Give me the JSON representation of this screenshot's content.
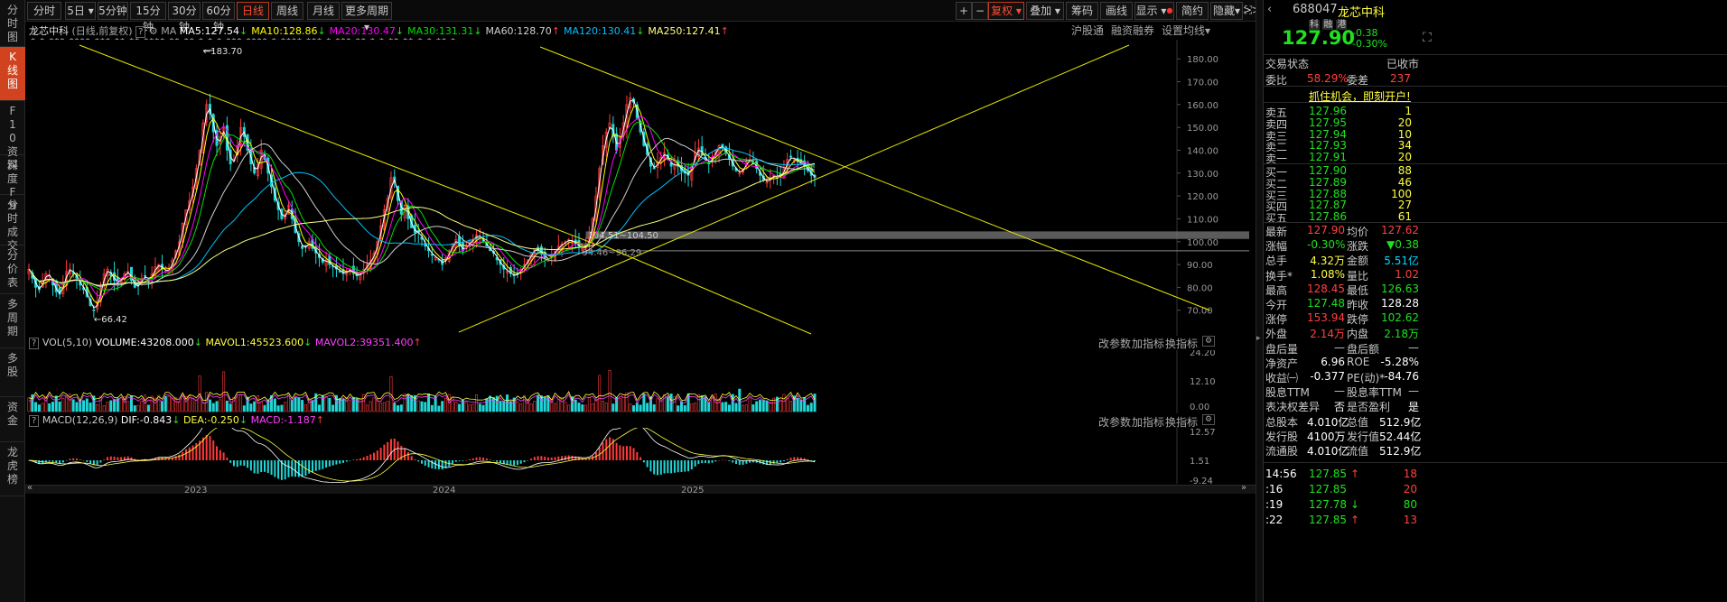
{
  "left_tabs": [
    "分时图",
    "K线图",
    "F10资料",
    "深度F9",
    "分时成交",
    "分价表",
    "多周期",
    "多股",
    "资金",
    "龙虎榜"
  ],
  "periods": [
    "分时",
    "5日",
    "5分钟",
    "15分钟",
    "30分钟",
    "60分钟",
    "日线",
    "周线",
    "月线",
    "更多周期"
  ],
  "toolbar": {
    "plus": "+",
    "minus": "−",
    "restore": "复权",
    "overlay": "叠加",
    "chips": "筹码",
    "draw": "画线",
    "display": "显示",
    "brief": "简约",
    "hide": "隐藏",
    "fwd": ">>",
    "expand": "⛶"
  },
  "chart": {
    "name": "龙芯中科",
    "mode": "(日线,前复权)",
    "ma_label": "MA",
    "ma": [
      {
        "name": "MA5",
        "value": "127.54",
        "color": "#ffffff",
        "arrow": "↓"
      },
      {
        "name": "MA10",
        "value": "128.86",
        "color": "#ffff00",
        "arrow": "↓"
      },
      {
        "name": "MA20",
        "value": "130.47",
        "color": "#ff00ff",
        "arrow": "↓"
      },
      {
        "name": "MA30",
        "value": "131.31",
        "color": "#00e000",
        "arrow": "↓"
      },
      {
        "name": "MA60",
        "value": "128.70",
        "color": "#d0d0d0",
        "arrow": "↑"
      },
      {
        "name": "MA120",
        "value": "130.41",
        "color": "#00c0ff",
        "arrow": "↓"
      },
      {
        "name": "MA250",
        "value": "127.41",
        "color": "#ffff80",
        "arrow": "↑"
      }
    ],
    "links": [
      "沪股通",
      "融资融券",
      "设置均线"
    ],
    "price_ticks": [
      "180.00",
      "170.00",
      "160.00",
      "150.00",
      "140.00",
      "130.00",
      "120.00",
      "110.00",
      "100.00",
      "90.00",
      "80.00",
      "70.00"
    ],
    "high_label": "183.70",
    "low_label": "66.42",
    "band_labels": [
      "104.51~104.50",
      "94.46~96.29"
    ],
    "x_labels": [
      "2023",
      "2024",
      "2025"
    ],
    "overlay_text": "*  *  *** **** ***  ** ** **** ** ** * *  * *** **** *  ****  *** * *** ** *  *  ** ** * *  ** *",
    "series": {
      "close": [
        88,
        84,
        80,
        79,
        83,
        86,
        85,
        81,
        78,
        77,
        82,
        87,
        88,
        86,
        84,
        81,
        79,
        76,
        72,
        70,
        74,
        80,
        86,
        88,
        85,
        83,
        82,
        84,
        86,
        87,
        83,
        80,
        81,
        84,
        85,
        83,
        86,
        89,
        90,
        88,
        87,
        88,
        92,
        96,
        100,
        108,
        114,
        118,
        124,
        132,
        140,
        152,
        160,
        156,
        148,
        142,
        146,
        150,
        140,
        134,
        136,
        142,
        150,
        146,
        140,
        134,
        130,
        134,
        140,
        136,
        130,
        124,
        118,
        114,
        110,
        112,
        116,
        110,
        104,
        100,
        97,
        98,
        100,
        97,
        95,
        93,
        91,
        92,
        90,
        89,
        88,
        87,
        86,
        87,
        88,
        86,
        85,
        86,
        88,
        90,
        92,
        95,
        100,
        107,
        114,
        119,
        128,
        126,
        118,
        112,
        116,
        110,
        106,
        104,
        104,
        101,
        98,
        96,
        94,
        93,
        92,
        90,
        93,
        96,
        99,
        101,
        98,
        96,
        98,
        100,
        101,
        103,
        102,
        100,
        98,
        96,
        95,
        92,
        90,
        88,
        87,
        86,
        85,
        86,
        88,
        90,
        92,
        95,
        97,
        96,
        95,
        93,
        92,
        94,
        96,
        98,
        99,
        100,
        101,
        100,
        99,
        98,
        97,
        98,
        102,
        110,
        120,
        132,
        142,
        148,
        152,
        146,
        140,
        146,
        152,
        160,
        163,
        161,
        154,
        148,
        142,
        138,
        133,
        132,
        135,
        137,
        139,
        136,
        133,
        134,
        133,
        131,
        130,
        129,
        134,
        139,
        141,
        138,
        136,
        134,
        137,
        140,
        142,
        141,
        139,
        136,
        133,
        131,
        130,
        132,
        135,
        136,
        134,
        132,
        129,
        127,
        126,
        128,
        129,
        128,
        129,
        132,
        136,
        137,
        136,
        135,
        134,
        133,
        131,
        129,
        128
      ],
      "minimum": 62,
      "maximum": 186
    },
    "vol": {
      "label": "VOL(5,10)",
      "volume": "VOLUME:43208.000",
      "volume_arrow": "↓",
      "mavol1": "MAVOL1:45523.600",
      "mavol1_arrow": "↓",
      "mavol2": "MAVOL2:39351.400",
      "mavol2_arrow": "↑",
      "ticks": [
        "24.20",
        "12.10",
        "0.00"
      ]
    },
    "macd": {
      "label": "MACD(12,26,9)",
      "dif": "DIF:-0.843",
      "dif_arrow": "↓",
      "dea": "DEA:-0.250",
      "dea_arrow": "↓",
      "macd": "MACD:-1.187",
      "macd_arrow": "↑",
      "ticks": [
        "12.57",
        "1.51",
        "-9.24"
      ]
    },
    "sub_buttons": [
      "改参数",
      "加指标",
      "换指标"
    ]
  },
  "right": {
    "code": "688047",
    "name": "龙芯中科",
    "tags": [
      "科",
      "融",
      "港"
    ],
    "price": "127.90",
    "change": "-0.38",
    "change_pct": "-0.30%",
    "status_label": "交易状态",
    "status": "已收市",
    "ratio_label": "委比",
    "ratio": "58.29%",
    "diff_label": "委差",
    "diff": "237",
    "promo": "抓住机会，即刻开户!",
    "sells": [
      {
        "l": "卖五",
        "p": "127.96",
        "v": "1"
      },
      {
        "l": "卖四",
        "p": "127.95",
        "v": "20"
      },
      {
        "l": "卖三",
        "p": "127.94",
        "v": "10"
      },
      {
        "l": "卖二",
        "p": "127.93",
        "v": "34"
      },
      {
        "l": "卖一",
        "p": "127.91",
        "v": "20"
      }
    ],
    "buys": [
      {
        "l": "买一",
        "p": "127.90",
        "v": "88"
      },
      {
        "l": "买二",
        "p": "127.89",
        "v": "46"
      },
      {
        "l": "买三",
        "p": "127.88",
        "v": "100"
      },
      {
        "l": "买四",
        "p": "127.87",
        "v": "27"
      },
      {
        "l": "买五",
        "p": "127.86",
        "v": "61"
      }
    ],
    "stats": [
      {
        "a": "最新",
        "av": "127.90",
        "ac": "#ff4040",
        "b": "均价",
        "bv": "127.62",
        "bc": "#ff4040"
      },
      {
        "a": "涨幅",
        "av": "-0.30%",
        "ac": "#20e020",
        "b": "涨跌",
        "bv": "▼0.38",
        "bc": "#20e020"
      },
      {
        "a": "总手",
        "av": "4.32万",
        "ac": "#ffff40",
        "b": "金额",
        "bv": "5.51亿",
        "bc": "#00d8ff"
      },
      {
        "a": "换手*",
        "av": "1.08%",
        "ac": "#ffff40",
        "b": "量比",
        "bv": "1.02",
        "bc": "#ff4040"
      },
      {
        "a": "最高",
        "av": "128.45",
        "ac": "#ff4040",
        "b": "最低",
        "bv": "126.63",
        "bc": "#20e020"
      },
      {
        "a": "今开",
        "av": "127.48",
        "ac": "#20e020",
        "b": "昨收",
        "bv": "128.28",
        "bc": "#ffffff"
      },
      {
        "a": "涨停",
        "av": "153.94",
        "ac": "#ff4040",
        "b": "跌停",
        "bv": "102.62",
        "bc": "#20e020"
      },
      {
        "a": "外盘",
        "av": "2.14万",
        "ac": "#ff4040",
        "b": "内盘",
        "bv": "2.18万",
        "bc": "#20e020"
      },
      {
        "a": "盘后量",
        "av": "—",
        "ac": "#c8c8c8",
        "b": "盘后额",
        "bv": "—",
        "bc": "#c8c8c8"
      },
      {
        "a": "净资产",
        "av": "6.96",
        "ac": "#ffffff",
        "b": "ROE",
        "bv": "-5.28%",
        "bc": "#ffffff"
      },
      {
        "a": "收益㈠",
        "av": "-0.377",
        "ac": "#ffffff",
        "b": "PE(动)*",
        "bv": "-84.76",
        "bc": "#ffffff"
      },
      {
        "a": "股息TTM",
        "av": "—",
        "ac": "#c8c8c8",
        "b": "股息率TTM",
        "bv": "—",
        "bc": "#c8c8c8"
      },
      {
        "a": "表决权差异",
        "av": "否",
        "ac": "#ffffff",
        "b": "是否盈利",
        "bv": "是",
        "bc": "#ffffff"
      },
      {
        "a": "总股本",
        "av": "4.010亿",
        "ac": "#ffffff",
        "b": "总值",
        "bv": "512.9亿",
        "bc": "#ffffff"
      },
      {
        "a": "发行股",
        "av": "4100万",
        "ac": "#ffffff",
        "b": "发行值",
        "bv": "52.44亿",
        "bc": "#ffffff"
      },
      {
        "a": "流通股",
        "av": "4.010亿",
        "ac": "#ffffff",
        "b": "流值",
        "bv": "512.9亿",
        "bc": "#ffffff"
      }
    ],
    "ticks": [
      {
        "t": "14:56",
        "p": "127.85",
        "pc": "#20e020",
        "arr": "↑",
        "ac": "#ff4040",
        "v": "18",
        "vc": "#ff4040"
      },
      {
        "t": ":16",
        "p": "127.85",
        "pc": "#20e020",
        "arr": "",
        "ac": "",
        "v": "20",
        "vc": "#ff4040"
      },
      {
        "t": ":19",
        "p": "127.78",
        "pc": "#20e020",
        "arr": "↓",
        "ac": "#20e020",
        "v": "80",
        "vc": "#20e020"
      },
      {
        "t": ":22",
        "p": "127.85",
        "pc": "#20e020",
        "arr": "↑",
        "ac": "#ff4040",
        "v": "13",
        "vc": "#ff4040"
      }
    ]
  }
}
